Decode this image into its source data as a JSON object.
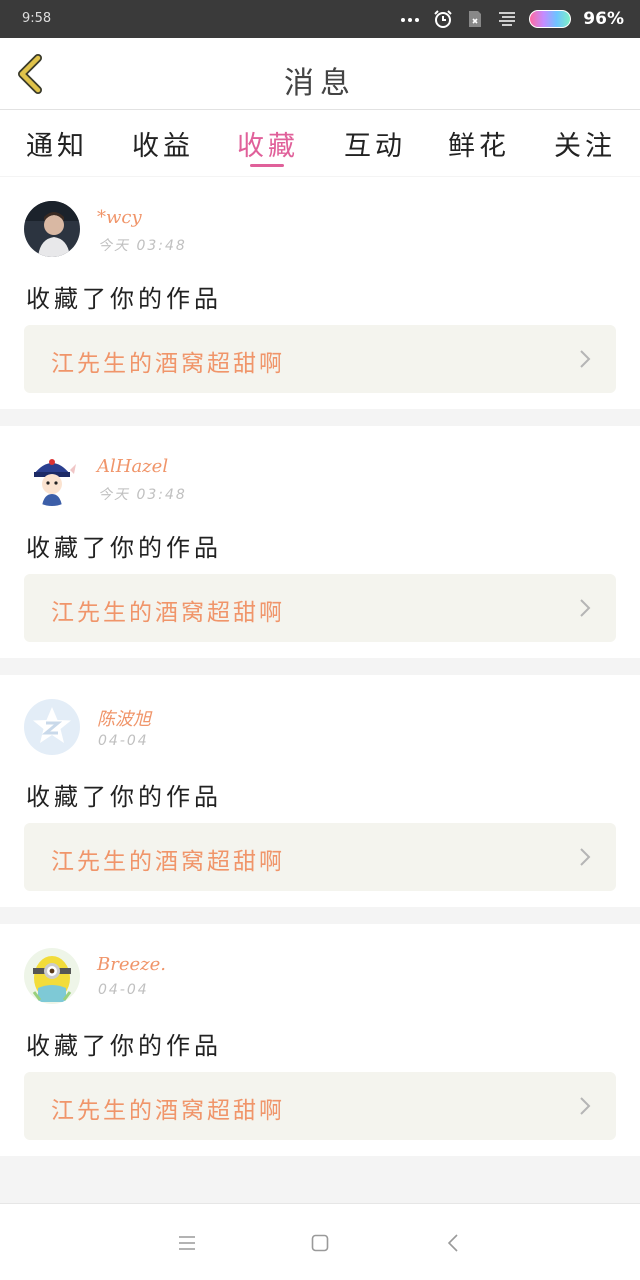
{
  "status_bar": {
    "time": "9:58",
    "battery": "96%"
  },
  "header": {
    "title": "消息"
  },
  "tabs": [
    {
      "label": "通知"
    },
    {
      "label": "收益"
    },
    {
      "label": "收藏",
      "active": true
    },
    {
      "label": "互动"
    },
    {
      "label": "鲜花"
    },
    {
      "label": "关注"
    }
  ],
  "messages": [
    {
      "username": "*wcy",
      "time": "今天 03:48",
      "text": "收藏了你的作品",
      "work_title": "江先生的酒窝超甜啊"
    },
    {
      "username": "AlHazel",
      "time": "今天 03:48",
      "text": "收藏了你的作品",
      "work_title": "江先生的酒窝超甜啊"
    },
    {
      "username": "陈波旭",
      "time": "04-04",
      "text": "收藏了你的作品",
      "work_title": "江先生的酒窝超甜啊"
    },
    {
      "username": "Breeze.",
      "time": "04-04",
      "text": "收藏了你的作品",
      "work_title": "江先生的酒窝超甜啊"
    }
  ],
  "colors": {
    "accent_pink": "#e0609a",
    "accent_orange": "#f0956a",
    "back_arrow": "#e0c34a"
  },
  "icons": {
    "back": "back-arrow-icon",
    "chevron": "chevron-right-icon",
    "nav_menu": "menu-icon",
    "nav_home": "home-square-icon",
    "nav_back": "back-triangle-icon"
  }
}
